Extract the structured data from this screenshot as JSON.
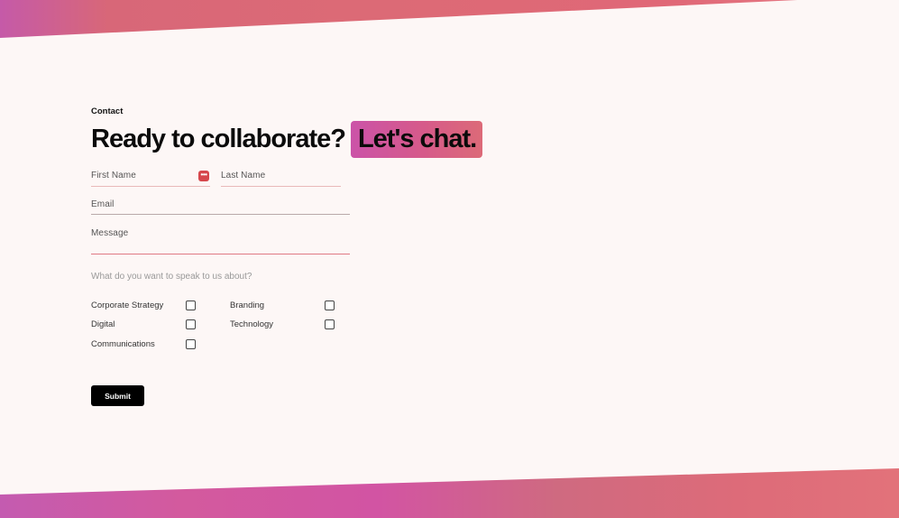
{
  "section_label": "Contact",
  "headline": {
    "main": "Ready to collaborate?",
    "accent": "Let's chat."
  },
  "form": {
    "first_name_label": "First Name",
    "last_name_label": "Last Name",
    "email_label": "Email",
    "message_label": "Message",
    "topic_prompt": "What do you want to speak to us about?",
    "topics": [
      {
        "label": "Corporate Strategy",
        "checked": false
      },
      {
        "label": "Branding",
        "checked": false
      },
      {
        "label": "Digital",
        "checked": false
      },
      {
        "label": "Technology",
        "checked": false
      },
      {
        "label": "Communications",
        "checked": false
      }
    ],
    "submit_label": "Submit",
    "password_manager_badge": "•••"
  },
  "colors": {
    "background": "#fdf7f6",
    "accent_gradient_start": "#cb53a8",
    "accent_gradient_end": "#dc6a78",
    "submit_button": "#000000",
    "badge": "#d6474c"
  }
}
